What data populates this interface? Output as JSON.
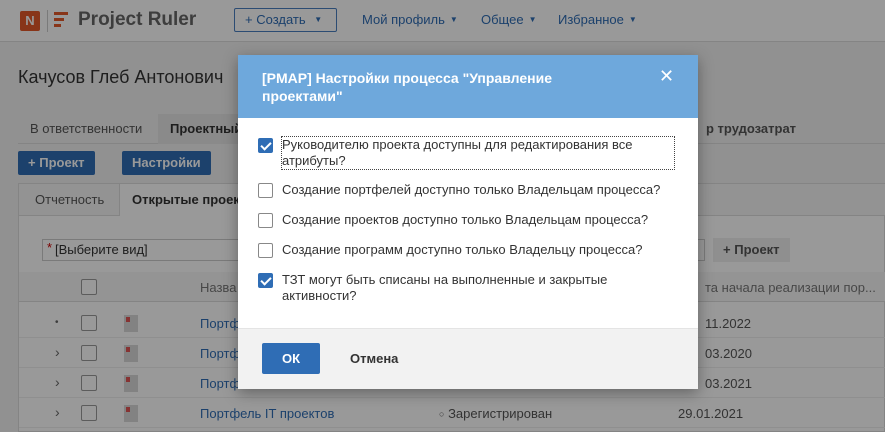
{
  "topbar": {
    "logo_mark": "N",
    "app_name": "Project Ruler",
    "create_label": "Создать",
    "nav": [
      {
        "label": "Мой профиль"
      },
      {
        "label": "Общее"
      },
      {
        "label": "Избранное"
      }
    ]
  },
  "page": {
    "title": "Качусов Глеб Антонович",
    "tabs": [
      {
        "label": "В ответственности"
      },
      {
        "label": "Проектный"
      },
      {
        "label": "р трудозатрат"
      }
    ],
    "actions": {
      "add_project": "Проект",
      "settings": "Настройки"
    },
    "subtabs": [
      {
        "label": "Отчетность"
      },
      {
        "label": "Открытые проект"
      }
    ],
    "view_select": "[Выберите вид]",
    "view_required_mark": "*",
    "panel_add_project": "Проект",
    "table": {
      "columns": {
        "name": "Назва",
        "date": "та начала реализации пор..."
      },
      "rows": [
        {
          "name": "Портф",
          "status": "",
          "date": "11.2022",
          "expand": "•"
        },
        {
          "name": "Портф",
          "status": "",
          "date": "03.2020",
          "expand": "›"
        },
        {
          "name": "Портф",
          "status": "",
          "date": "03.2021",
          "expand": "›"
        },
        {
          "name": "Портфель IT проектов",
          "status": "Зарегистрирован",
          "date": "29.01.2021",
          "expand": "›"
        }
      ]
    }
  },
  "modal": {
    "title": "[PMAP] Настройки процесса \"Управление проектами\"",
    "options": [
      {
        "label": "Руководителю проекта доступны для редактирования все атрибуты?",
        "checked": true
      },
      {
        "label": "Создание портфелей доступно только Владельцам процесса?",
        "checked": false
      },
      {
        "label": "Создание проектов доступно только Владельцам процесса?",
        "checked": false
      },
      {
        "label": "Создание программ доступно только Владельцу процесса?",
        "checked": false
      },
      {
        "label": "ТЗТ могут быть списаны на выполненные и закрытые активности?",
        "checked": true
      }
    ],
    "ok_label": "ОК",
    "cancel_label": "Отмена"
  },
  "colors": {
    "accent": "#2f6db5",
    "modal_header": "#6ea8dc",
    "logo": "#e3592a"
  },
  "icons": [
    "logo-n-icon",
    "menu-lines-icon",
    "plus-icon",
    "caret-down-icon",
    "minimize-icon",
    "close-icon",
    "checkbox-icon",
    "chevron-right-icon",
    "document-icon"
  ]
}
